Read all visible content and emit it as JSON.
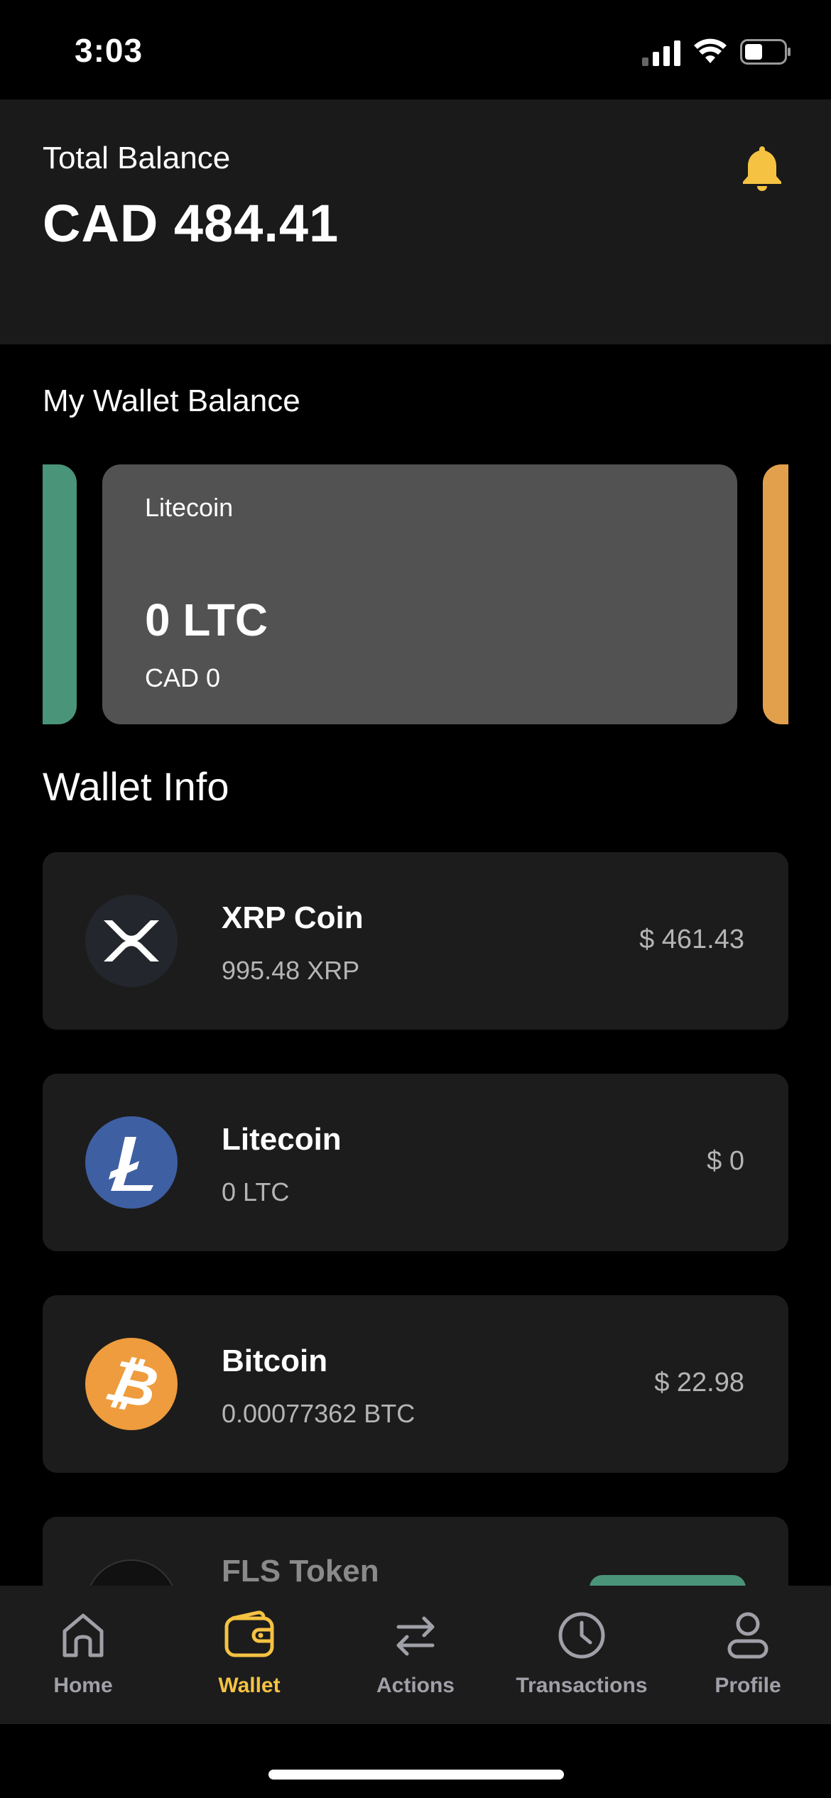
{
  "status_bar": {
    "time": "3:03"
  },
  "header": {
    "total_label": "Total Balance",
    "total_value": "CAD 484.41",
    "bell_color": "#f5c242"
  },
  "wallet_balance": {
    "title": "My Wallet Balance",
    "active_card": {
      "name": "Litecoin",
      "amount": "0 LTC",
      "fiat": "CAD 0"
    }
  },
  "wallet_info": {
    "title": "Wallet Info",
    "items": [
      {
        "name": "XRP Coin",
        "amount": "995.48 XRP",
        "value": "$ 461.43",
        "icon": "xrp-icon"
      },
      {
        "name": "Litecoin",
        "amount": "0 LTC",
        "value": "$ 0",
        "icon": "litecoin-icon"
      },
      {
        "name": "Bitcoin",
        "amount": "0.00077362 BTC",
        "value": "$ 22.98",
        "icon": "bitcoin-icon"
      },
      {
        "name": "FLS Token",
        "icon": "fls-icon"
      }
    ]
  },
  "tabs": [
    {
      "label": "Home",
      "icon": "home-icon"
    },
    {
      "label": "Wallet",
      "icon": "wallet-icon",
      "active": true
    },
    {
      "label": "Actions",
      "icon": "swap-icon"
    },
    {
      "label": "Transactions",
      "icon": "clock-icon"
    },
    {
      "label": "Profile",
      "icon": "user-icon"
    }
  ],
  "colors": {
    "accent": "#f5c242",
    "green": "#4a9479",
    "orange": "#e3a04c"
  }
}
